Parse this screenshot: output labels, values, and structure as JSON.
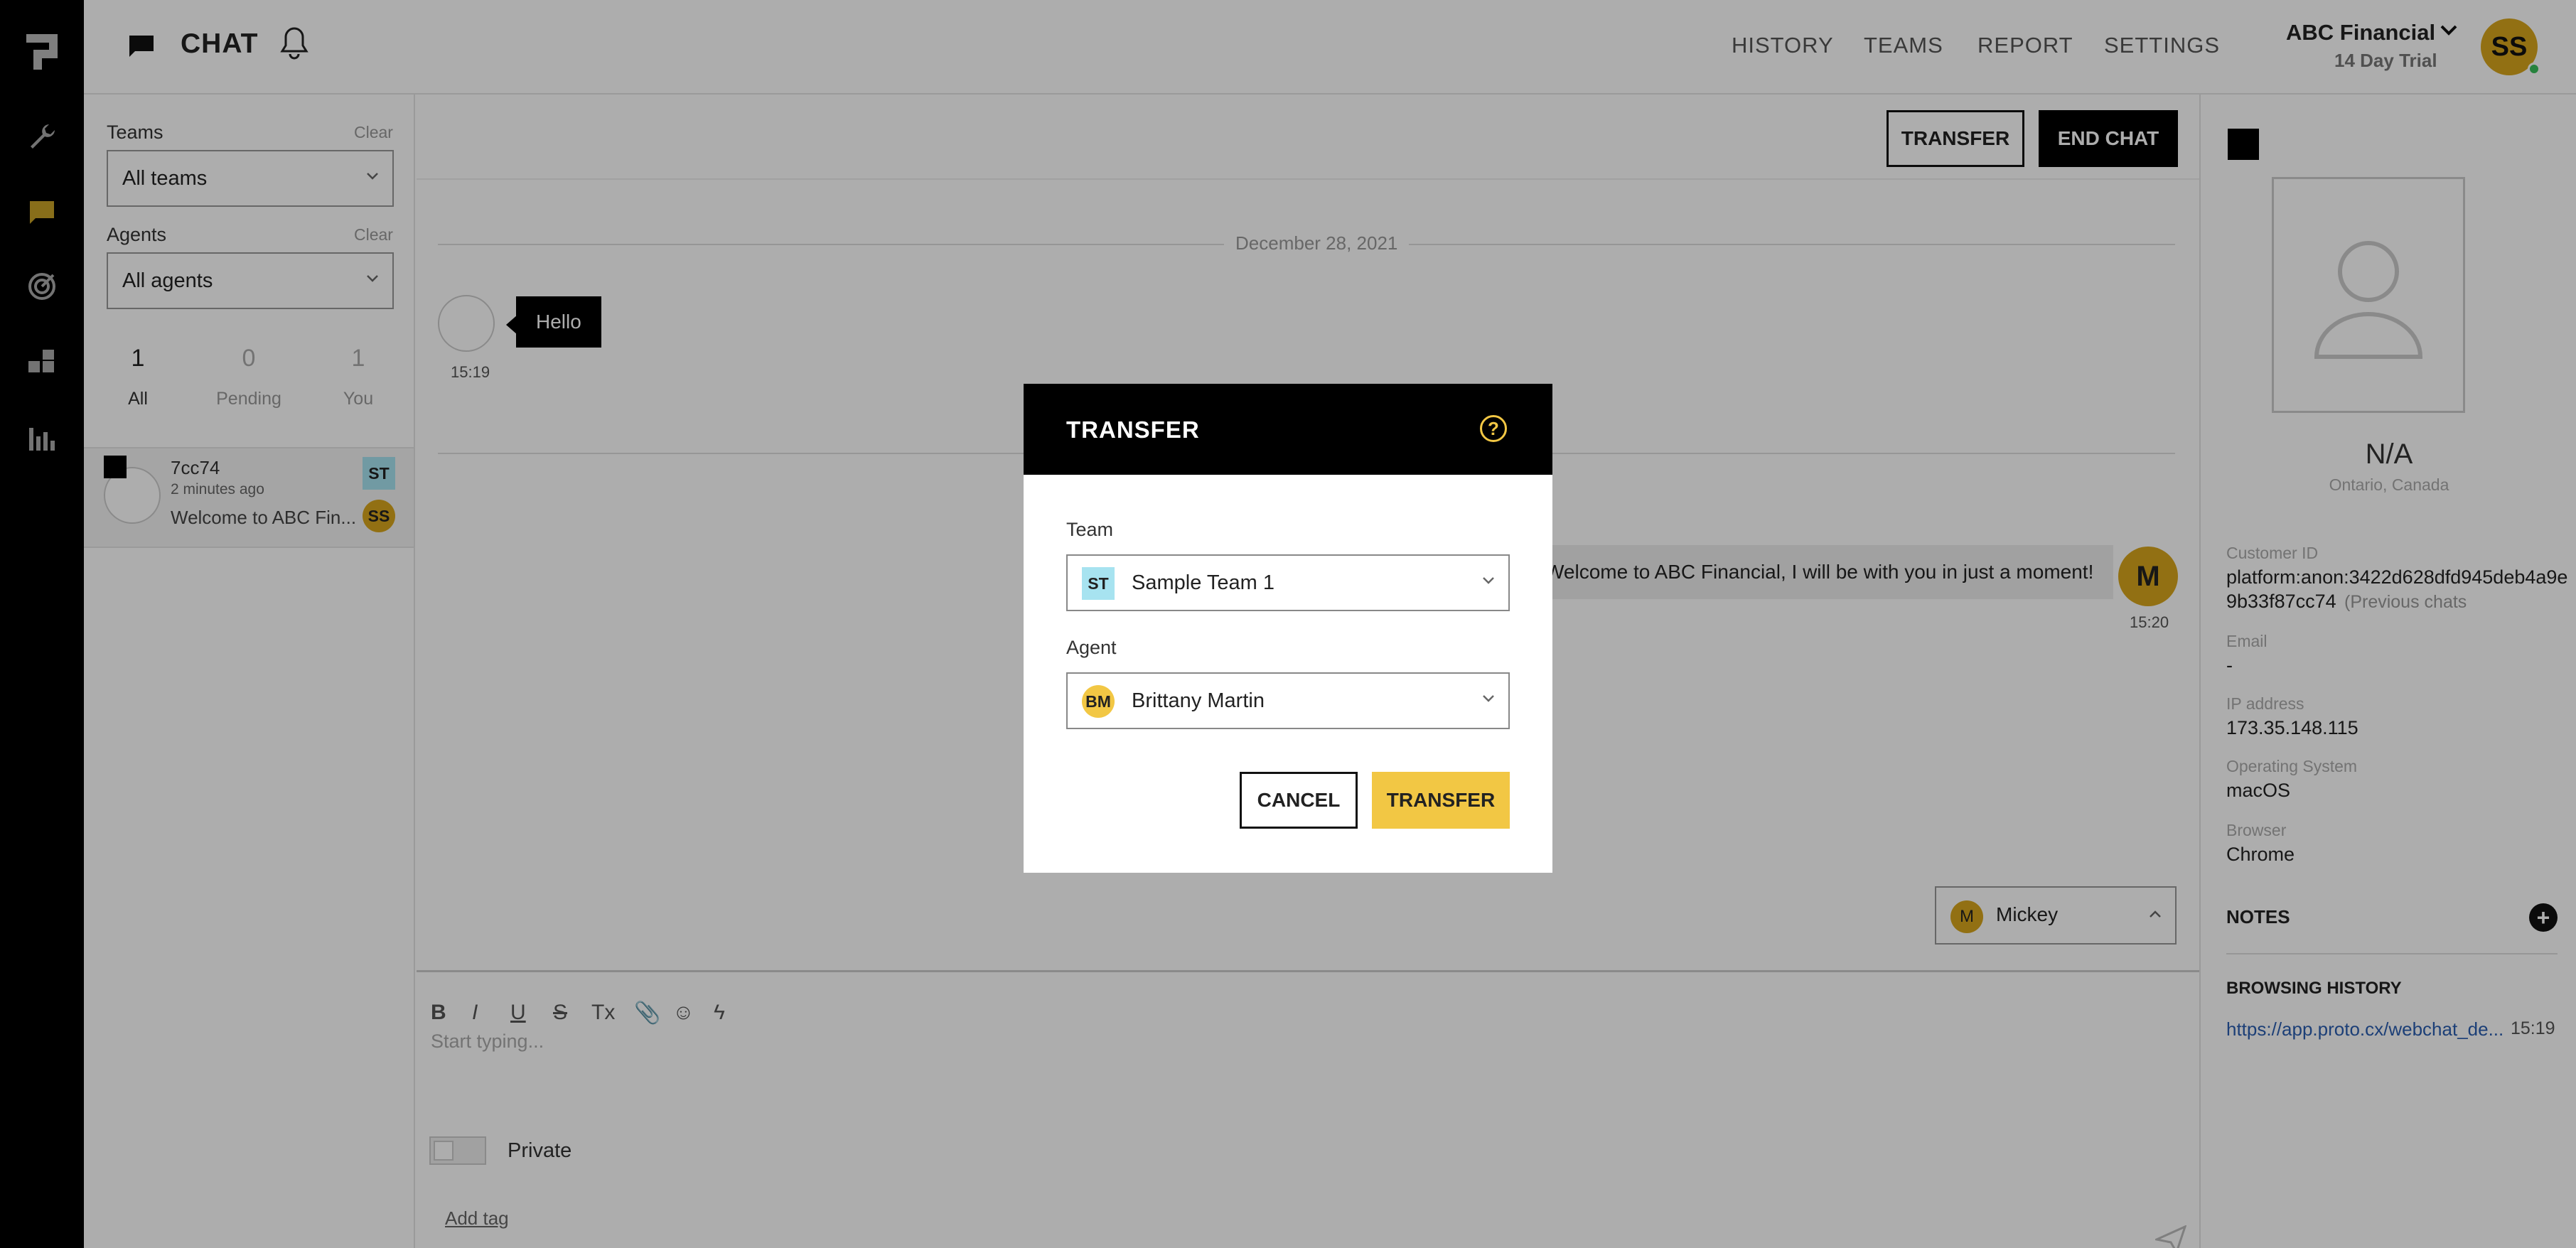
{
  "app": {
    "section_title": "CHAT"
  },
  "header": {
    "nav": [
      "HISTORY",
      "TEAMS",
      "REPORT",
      "SETTINGS"
    ],
    "org_name": "ABC Financial",
    "trial": "14 Day Trial",
    "user_initials": "SS"
  },
  "filters": {
    "teams_label": "Teams",
    "teams_clear": "Clear",
    "teams_value": "All teams",
    "agents_label": "Agents",
    "agents_clear": "Clear",
    "agents_value": "All agents",
    "counts": [
      {
        "value": "1",
        "label": "All"
      },
      {
        "value": "0",
        "label": "Pending"
      },
      {
        "value": "1",
        "label": "You"
      }
    ]
  },
  "conversation": {
    "id": "7cc74",
    "time": "2 minutes ago",
    "preview": "Welcome to ABC Fin...",
    "team_badge": "ST",
    "agent_badge": "SS"
  },
  "chat": {
    "transfer_label": "TRANSFER",
    "end_label": "END CHAT",
    "date": "December 28, 2021",
    "msg1": {
      "text": "Hello",
      "time": "15:19"
    },
    "msg2": {
      "text": "Welcome to ABC Financial, I will be with you in just a moment!",
      "time": "15:20",
      "initial": "M"
    },
    "agent_selector": {
      "initial": "M",
      "name": "Mickey"
    },
    "placeholder": "Start typing...",
    "private_label": "Private",
    "add_tag": "Add tag",
    "toolbar": [
      "B",
      "I",
      "U",
      "S",
      "Tx",
      "📎",
      "☺",
      "ϟ"
    ]
  },
  "customer": {
    "name": "N/A",
    "location": "Ontario, Canada",
    "id_label": "Customer ID",
    "id_value_1": "platform:anon:3422d628dfd945deb4a9e",
    "id_value_2": "9b33f87cc74",
    "previous_chats": "(Previous chats",
    "email_label": "Email",
    "email_value": "-",
    "ip_label": "IP address",
    "ip_value": "173.35.148.115",
    "os_label": "Operating System",
    "os_value": "macOS",
    "browser_label": "Browser",
    "browser_value": "Chrome",
    "notes_label": "NOTES",
    "history_label": "BROWSING HISTORY",
    "history_url": "https://app.proto.cx/webchat_de...",
    "history_time": "15:19"
  },
  "modal": {
    "title": "TRANSFER",
    "team_label": "Team",
    "team_badge": "ST",
    "team_value": "Sample Team 1",
    "agent_label": "Agent",
    "agent_badge": "BM",
    "agent_value": "Brittany Martin",
    "cancel": "CANCEL",
    "confirm": "TRANSFER"
  }
}
